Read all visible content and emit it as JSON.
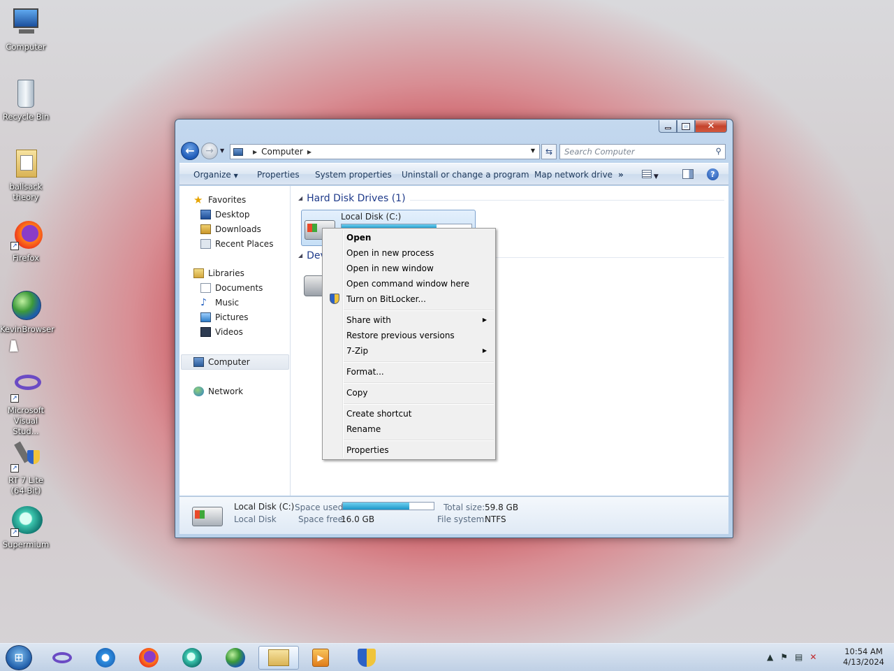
{
  "desktop": {
    "icons": [
      {
        "label": "Computer"
      },
      {
        "label": "Recycle Bin"
      },
      {
        "label": "ballsack theory"
      },
      {
        "label": "Firefox"
      },
      {
        "label": "KevinBrowser"
      },
      {
        "label": "Microsoft Visual Stud..."
      },
      {
        "label": "RT 7 Lite (64-Bit)"
      },
      {
        "label": "Supermium"
      }
    ]
  },
  "window": {
    "address": {
      "crumb": "Computer"
    },
    "search_placeholder": "Search Computer",
    "toolbar": {
      "organize": "Organize",
      "properties": "Properties",
      "system_properties": "System properties",
      "uninstall": "Uninstall or change a program",
      "map_drive": "Map network drive",
      "more": "»"
    },
    "sidebar": {
      "favorites": "Favorites",
      "desktop": "Desktop",
      "downloads": "Downloads",
      "recent": "Recent Places",
      "libraries": "Libraries",
      "documents": "Documents",
      "music": "Music",
      "pictures": "Pictures",
      "videos": "Videos",
      "computer": "Computer",
      "network": "Network"
    },
    "content": {
      "hdd_group": "Hard Disk Drives (1)",
      "drive_name": "Local Disk (C:)",
      "drive_used_fraction": 0.73,
      "devices_group_partial": "Dev"
    },
    "details": {
      "name": "Local Disk (C:)",
      "type": "Local Disk",
      "space_used_label": "Space used:",
      "space_free_label": "Space free:",
      "space_free": "16.0 GB",
      "total_size_label": "Total size:",
      "total_size": "59.8 GB",
      "file_system_label": "File system:",
      "file_system": "NTFS"
    }
  },
  "context_menu": {
    "open": "Open",
    "open_new_process": "Open in new process",
    "open_new_window": "Open in new window",
    "open_cmd": "Open command window here",
    "bitlocker": "Turn on BitLocker...",
    "share_with": "Share with",
    "restore": "Restore previous versions",
    "zip": "7-Zip",
    "format": "Format...",
    "copy": "Copy",
    "create_shortcut": "Create shortcut",
    "rename": "Rename",
    "properties": "Properties"
  },
  "taskbar": {
    "time": "10:54 AM",
    "date": "4/13/2024"
  }
}
